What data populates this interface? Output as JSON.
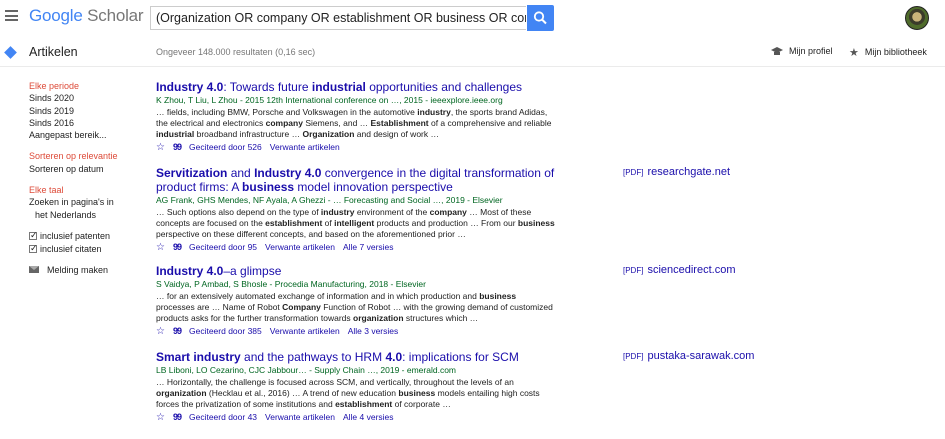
{
  "header": {
    "logo_google": "Google",
    "logo_scholar": "Scholar",
    "search_value": "(Organization OR company OR establishment OR business OR corporation) ."
  },
  "subbar": {
    "section": "Artikelen",
    "stats": "Ongeveer 148.000 resultaten (0,16 sec)",
    "profile": "Mijn profiel",
    "library": "Mijn bibliotheek"
  },
  "sidebar": {
    "period_header": "Elke periode",
    "periods": [
      "Sinds 2020",
      "Sinds 2019",
      "Sinds 2016",
      "Aangepast bereik..."
    ],
    "sort_relevance": "Sorteren op relevantie",
    "sort_date": "Sorteren op datum",
    "lang_header": "Elke taal",
    "lang_dutch_1": "Zoeken in pagina's in",
    "lang_dutch_2": "het Nederlands",
    "patents": "inclusief patenten",
    "citations": "inclusief citaten",
    "alert": "Melding maken"
  },
  "results": [
    {
      "title_parts": [
        "Industry 4.0",
        ": Towards future ",
        "industrial",
        " opportunities and challenges"
      ],
      "authors": "K Zhou, T Liu, L Zhou - 2015 12th International conference on …, 2015 - ieeexplore.ieee.org",
      "snippet": [
        "… fields, including BMW, Porsche and Volkswagen in the automotive ",
        "industry",
        ", the sports brand Adidas, the electrical and electronics ",
        "company",
        " Siemens, and … ",
        "Establishment",
        " of a comprehensive and reliable ",
        "industrial",
        " broadband infrastructure … ",
        "Organization",
        " and design of work …"
      ],
      "cited": "Geciteerd door 526",
      "related": "Verwante artikelen",
      "versions": "",
      "pdf_tag": "",
      "pdf_source": ""
    },
    {
      "title_parts": [
        "Servitization",
        " and ",
        "Industry 4.0",
        " convergence in the digital transformation of product firms: A ",
        "business",
        " model innovation perspective"
      ],
      "authors": "AG Frank, GHS Mendes, NF Ayala, A Ghezzi - … Forecasting and Social …, 2019 - Elsevier",
      "snippet": [
        "… Such options also depend on the type of ",
        "industry",
        " environment of the ",
        "company",
        " … Most of these concepts are focused on the ",
        "establishment",
        " of ",
        "intelligent",
        " products and production … From our ",
        "business",
        " perspective on these different concepts, and based on the aforementioned prior …"
      ],
      "cited": "Geciteerd door 95",
      "related": "Verwante artikelen",
      "versions": "Alle 7 versies",
      "pdf_tag": "[PDF]",
      "pdf_source": "researchgate.net"
    },
    {
      "title_parts": [
        "Industry 4.0",
        "–a glimpse",
        "",
        ""
      ],
      "authors": "S Vaidya, P Ambad, S Bhosle - Procedia Manufacturing, 2018 - Elsevier",
      "snippet": [
        "… for an extensively automated exchange of information and in which production and ",
        "business",
        " processes are … Name of Robot ",
        "Company",
        " Function of Robot … with the growing demand of customized products asks for the further transformation towards ",
        "organization",
        " structures which …",
        "",
        "",
        "",
        ""
      ],
      "cited": "Geciteerd door 385",
      "related": "Verwante artikelen",
      "versions": "Alle 3 versies",
      "pdf_tag": "[PDF]",
      "pdf_source": "sciencedirect.com"
    },
    {
      "title_parts": [
        "Smart industry",
        " and the pathways to HRM ",
        "4.0",
        ": implications for SCM"
      ],
      "authors": "LB Liboni, LO Cezarino, CJC Jabbour… - Supply Chain …, 2019 - emerald.com",
      "snippet": [
        "… Horizontally, the challenge is focused across SCM, and vertically, throughout the levels of an ",
        "organization",
        " (Hecklau et al., 2016) … A trend of new education ",
        "business",
        " models entailing high costs forces the privatization of some institutions and ",
        "establishment",
        " of corporate …",
        "",
        "",
        "",
        ""
      ],
      "cited": "Geciteerd door 43",
      "related": "Verwante artikelen",
      "versions": "Alle 4 versies",
      "pdf_tag": "[PDF]",
      "pdf_source": "pustaka-sarawak.com"
    }
  ]
}
